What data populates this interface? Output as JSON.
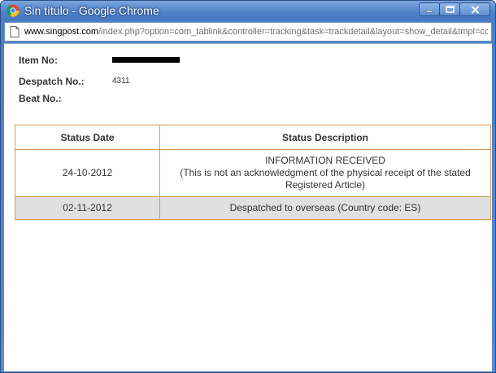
{
  "window": {
    "title": "Sin título - Google Chrome"
  },
  "address": {
    "host": "www.singpost.com",
    "path": "/index.php?option=com_tablink&controller=tracking&task=trackdetail&layout=show_detail&tmpl=cc"
  },
  "details": {
    "item_no_label": "Item No:",
    "despatch_no_label": "Despatch No.:",
    "despatch_no_value": "4311",
    "beat_no_label": "Beat No.:"
  },
  "table": {
    "headers": [
      "Status Date",
      "Status Description"
    ],
    "rows": [
      {
        "date": "24-10-2012",
        "description_line1": "INFORMATION RECEIVED",
        "description_line2": "(This is not an acknowledgment of the physical receipt of the stated Registered Article)"
      },
      {
        "date": "02-11-2012",
        "description_line1": "Despatched to overseas (Country code: ES)"
      }
    ]
  },
  "colors": {
    "table_border": "#d09a55",
    "alt_row_bg": "#e0e0e0",
    "titlebar": "#4f82c9"
  },
  "icons": [
    "chrome-icon",
    "minimize-icon",
    "maximize-icon",
    "close-icon",
    "page-icon"
  ]
}
